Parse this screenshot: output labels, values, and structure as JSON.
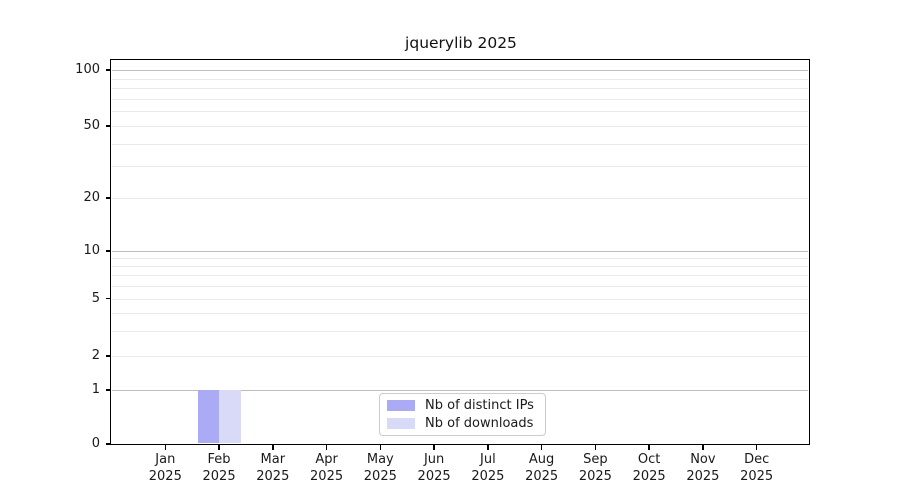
{
  "chart_data": {
    "type": "bar",
    "title": "jquerylib 2025",
    "x_axis": {
      "months": [
        "Jan",
        "Feb",
        "Mar",
        "Apr",
        "May",
        "Jun",
        "Jul",
        "Aug",
        "Sep",
        "Oct",
        "Nov",
        "Dec"
      ],
      "year": "2025"
    },
    "y_axis": {
      "scale": "symlog",
      "tick_values": [
        100,
        50,
        20,
        10,
        5,
        2,
        1,
        0
      ],
      "range": [
        0,
        112
      ],
      "minor_gridline_values": [
        2,
        3,
        4,
        5,
        6,
        7,
        8,
        9,
        20,
        30,
        40,
        50,
        60,
        70,
        80,
        90
      ],
      "major_gridline_values": [
        1,
        10,
        100
      ]
    },
    "series": [
      {
        "name": "Nb of distinct IPs",
        "color": "#abaaf5",
        "values": [
          0,
          1,
          0,
          0,
          0,
          0,
          0,
          0,
          0,
          0,
          0,
          0
        ]
      },
      {
        "name": "Nb of downloads",
        "color": "#d9d9f8",
        "values": [
          0,
          1,
          0,
          0,
          0,
          0,
          0,
          0,
          0,
          0,
          0,
          0
        ]
      }
    ],
    "grid": true,
    "legend": {
      "position": "inside-bottom-center"
    },
    "colors": {
      "background": "#ffffff",
      "spine": "#000000",
      "major_gridline": "#bdbdbd",
      "minor_gridline": "#e9e9e9",
      "text": "#1a1a1a",
      "legend_border": "#cccccc"
    }
  }
}
